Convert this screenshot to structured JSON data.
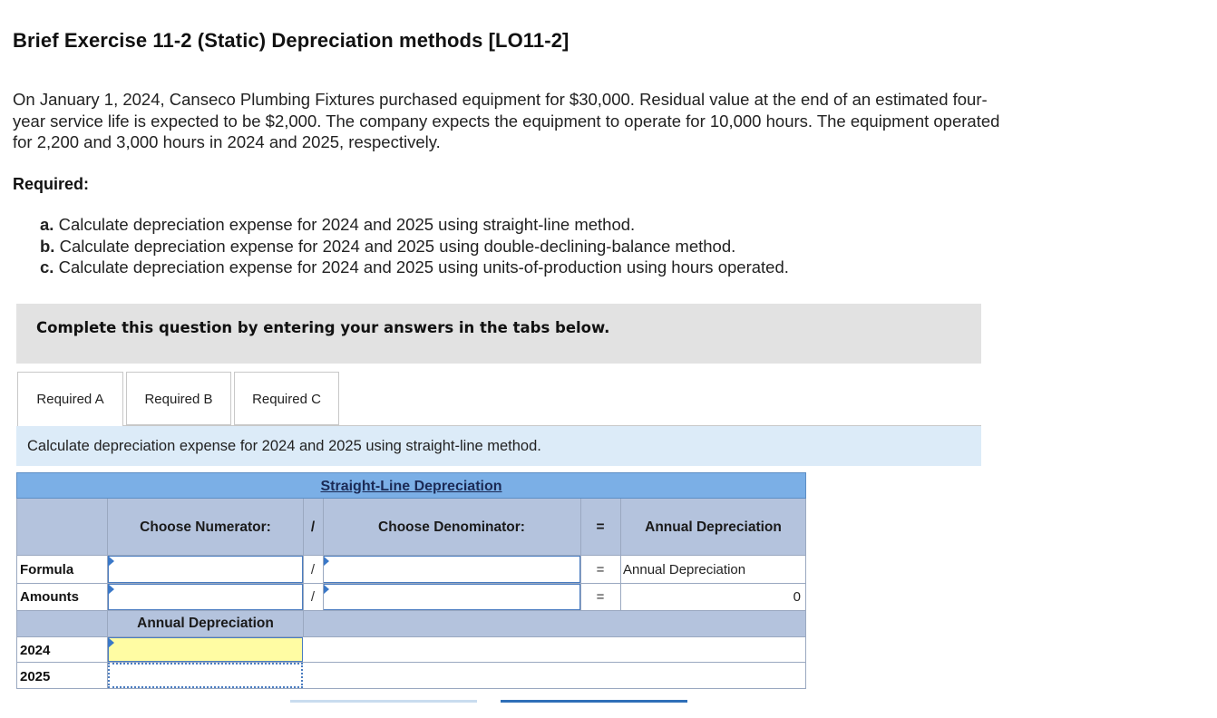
{
  "title": "Brief Exercise 11-2 (Static) Depreciation methods [LO11-2]",
  "problem": {
    "line1": "On January 1, 2024, Canseco Plumbing Fixtures purchased equipment for $30,000. Residual value at the end of an estimated four-",
    "line2": "year service life is expected to be $2,000. The company expects the equipment to operate for 10,000 hours. The equipment operated",
    "line3": "for 2,200 and 3,000 hours in 2024 and 2025, respectively."
  },
  "required": {
    "heading": "Required:",
    "items": [
      {
        "letter": "a.",
        "text": " Calculate depreciation expense for 2024 and 2025 using straight-line method."
      },
      {
        "letter": "b.",
        "text": " Calculate depreciation expense for 2024 and 2025 using double-declining-balance method."
      },
      {
        "letter": "c.",
        "text": " Calculate depreciation expense for 2024 and 2025 using units-of-production using hours operated."
      }
    ]
  },
  "complete_box": "Complete this question by entering your answers in the tabs below.",
  "tabs": [
    {
      "label": "Required A",
      "active": true
    },
    {
      "label": "Required B",
      "active": false
    },
    {
      "label": "Required C",
      "active": false
    }
  ],
  "instruction": "Calculate depreciation expense for 2024 and 2025 using straight-line method.",
  "table": {
    "caption": "Straight-Line Depreciation",
    "headers": {
      "numerator": "Choose Numerator:",
      "divide": "/",
      "denominator": "Choose Denominator:",
      "equals": "=",
      "result": "Annual Depreciation"
    },
    "rows": {
      "formula": {
        "label": "Formula",
        "divide": "/",
        "equals": "=",
        "result": "Annual Depreciation"
      },
      "amounts": {
        "label": "Amounts",
        "divide": "/",
        "equals": "=",
        "result": "0"
      }
    },
    "sub_header": "Annual Depreciation",
    "years": [
      "2024",
      "2025"
    ]
  },
  "colors": {
    "caption_bg": "#7bafe6",
    "header_bg": "#b4c3dd",
    "instruction_bg": "#dcebf8",
    "complete_bg": "#e2e2e2",
    "active_input": "#fffca3"
  }
}
